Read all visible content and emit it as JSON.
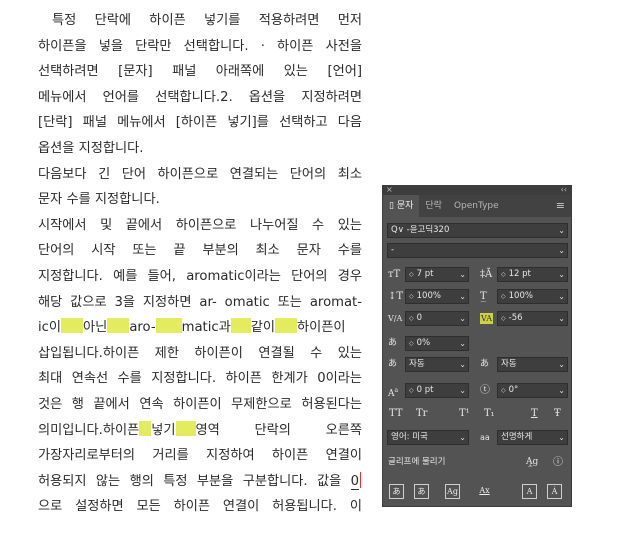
{
  "document": {
    "lines": [
      {
        "segs": [
          {
            "t": "특정 단락에 하이픈 넣기를 적용하려면 먼저"
          }
        ],
        "indent": true
      },
      {
        "segs": [
          {
            "t": "하이픈을 넣을 단락만 선택합니다. · 하이픈 사전을"
          }
        ]
      },
      {
        "segs": [
          {
            "t": "선택하려면 [문자] 패널 아래쪽에 있는 [언어]"
          }
        ]
      },
      {
        "segs": [
          {
            "t": "메뉴에서 언어를 선택합니다.2. 옵션을 지정하려면"
          }
        ]
      },
      {
        "segs": [
          {
            "t": "[단락] 패널 메뉴에서 [하이픈 넣기]를 선택하고 다음"
          }
        ]
      },
      {
        "segs": [
          {
            "t": "옵션을 지정합니다."
          }
        ],
        "last": true
      },
      {
        "segs": [
          {
            "t": "다음보다 긴 단어 하이픈으로 연결되는 단어의 최소"
          }
        ]
      },
      {
        "segs": [
          {
            "t": "문자 수를 지정합니다."
          }
        ],
        "last": true
      },
      {
        "segs": [
          {
            "t": "시작에서 및 끝에서 하이픈으로 나누어질 수 있는"
          }
        ]
      },
      {
        "segs": [
          {
            "t": "단어의 시작 또는 끝 부분의 최소 문자 수를"
          }
        ]
      },
      {
        "segs": [
          {
            "t": "지정합니다. 예를 들어, aromatic이라는 단어의 경우"
          }
        ]
      },
      {
        "segs": [
          {
            "t": "해당 값으로 3을 지정하면 ar- omatic 또는 aromat-"
          }
        ]
      },
      {
        "segs": [
          {
            "t": "ic이"
          },
          {
            "hl": 22
          },
          {
            "t": "아닌"
          },
          {
            "hl": 22
          },
          {
            "t": "aro-"
          },
          {
            "hl": 26
          },
          {
            "t": "matic과"
          },
          {
            "hl": 20
          },
          {
            "t": "같이"
          },
          {
            "hl": 22
          },
          {
            "t": "하이픈이"
          }
        ]
      },
      {
        "segs": [
          {
            "t": "삽입됩니다.하이픈 제한 하이픈이 연결될 수 있는"
          }
        ]
      },
      {
        "segs": [
          {
            "t": "최대 연속선 수를 지정합니다. 하이픈 한계가 0이라는"
          }
        ]
      },
      {
        "segs": [
          {
            "t": "것은 행 끝에서 연속 하이픈이 무제한으로 허용된다는"
          }
        ]
      },
      {
        "segs": [
          {
            "t": "의미입니다.하이픈"
          },
          {
            "hl": 12
          },
          {
            "t": "넣기"
          },
          {
            "hl": 20
          },
          {
            "t": "영역 단락의 오른쪽"
          }
        ]
      },
      {
        "segs": [
          {
            "t": "가장자리로부터의 거리를 지정하여 하이픈 연결이"
          }
        ]
      },
      {
        "segs": [
          {
            "t": "허용되지 않는 행의 특정 부분을 구분합니다. 값을 "
          },
          {
            "u": "0"
          },
          {
            "cur": true
          }
        ]
      },
      {
        "segs": [
          {
            "t": "으로 설정하면 모든 하이픈 연결이 허용됩니다. 이"
          }
        ]
      }
    ]
  },
  "panel": {
    "close": "×",
    "collapse": "‹‹",
    "tabs": [
      "문자",
      "단락",
      "OpenType"
    ],
    "menu_icon": "hamburger-icon",
    "font_search": "Q∨",
    "font_family": "-윤고딕320",
    "font_style": "-",
    "font_size": "7 pt",
    "leading": "12 pt",
    "vscale": "100%",
    "hscale": "100%",
    "kerning": "0",
    "tracking": "-56",
    "tsume": "0%",
    "aki_left": "자동",
    "aki_right": "자동",
    "baseline": "0 pt",
    "rotation": "0°",
    "language": "영어: 미국",
    "antialias": "선명하게",
    "snap_label": "글리프에 물리기",
    "icons": {
      "size": "TT",
      "leading": "A/A",
      "vscale": "IT",
      "hscale": "T",
      "kern": "V/A",
      "track": "VA",
      "tsume": "あ",
      "aki": "あ",
      "baseline": "A/a",
      "rotate": "T",
      "aa": "aa"
    },
    "style_buttons": [
      "TT",
      "Tr",
      "T¹",
      "T₁",
      "T",
      "Ŧ"
    ],
    "bottom_buttons": [
      "あ",
      "あ",
      "Ag",
      "Ax",
      "A",
      "Á"
    ]
  }
}
